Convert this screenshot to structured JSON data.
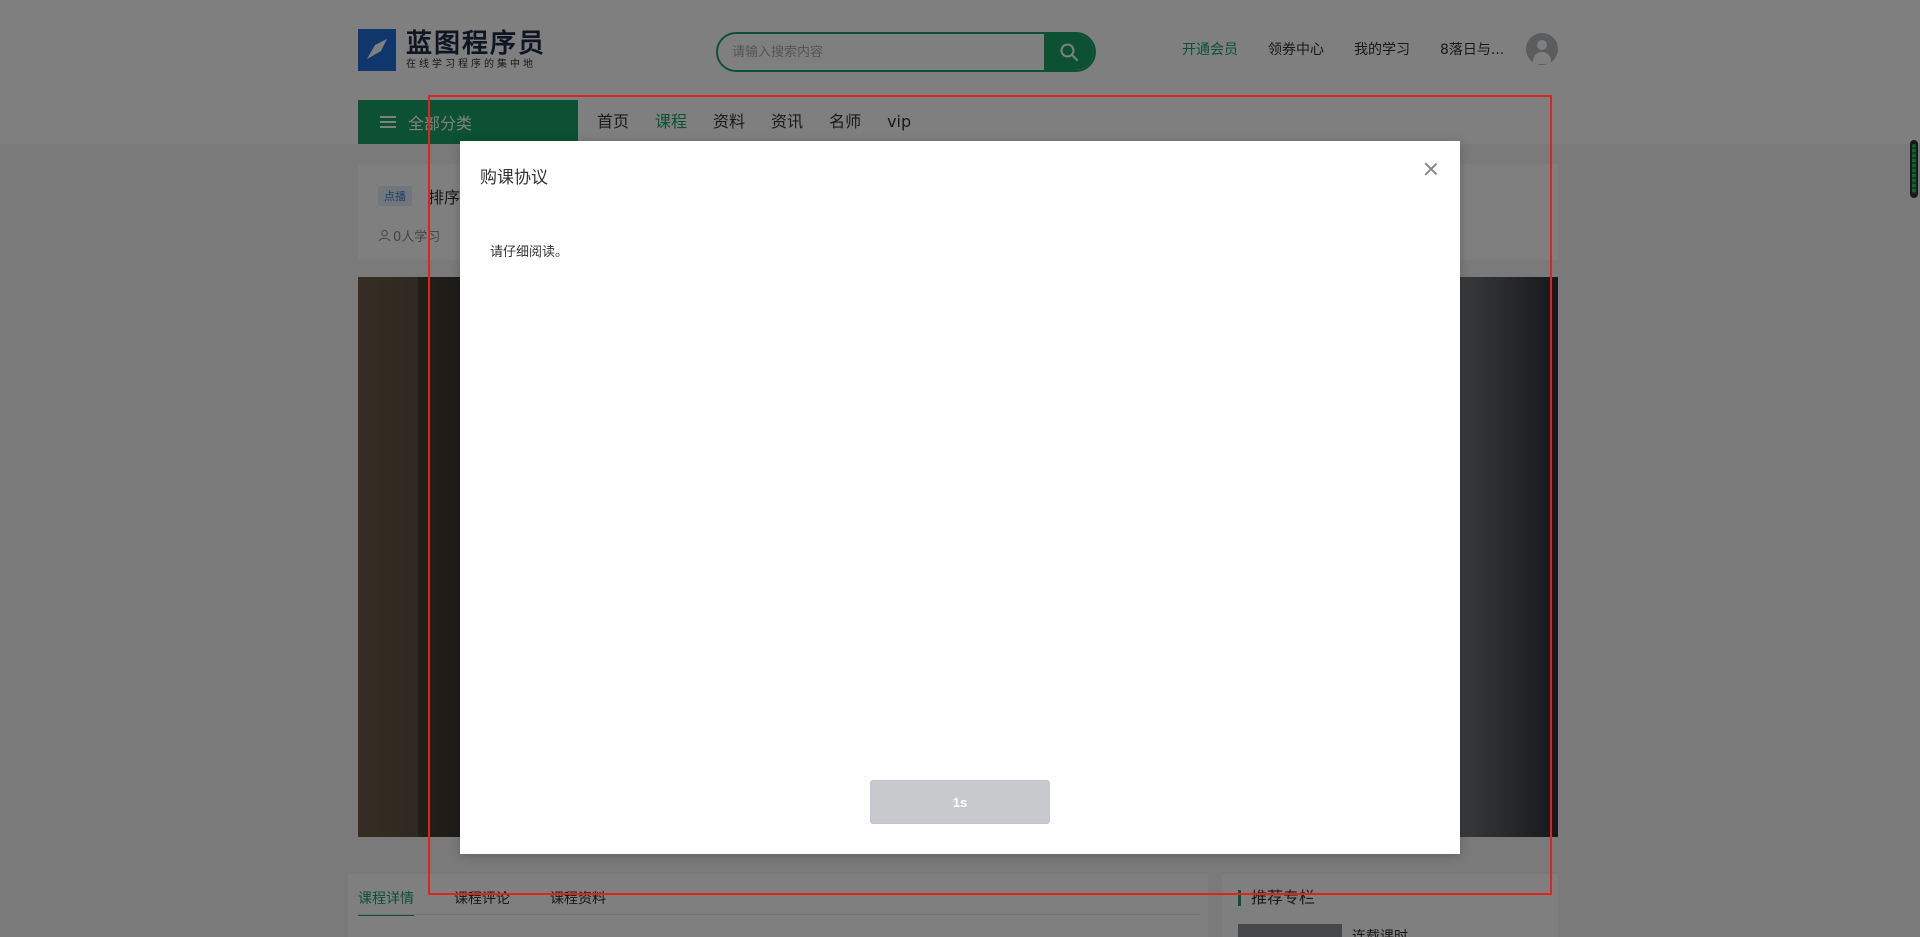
{
  "header": {
    "logo_title": "蓝图程序员",
    "logo_subtitle": "在线学习程序的集中地",
    "search_placeholder": "请输入搜索内容",
    "links": [
      "开通会员",
      "领券中心",
      "我的学习",
      "8落日与..."
    ],
    "all_categories": "全部分类",
    "nav": [
      "首页",
      "课程",
      "资料",
      "资讯",
      "名师",
      "vip"
    ],
    "nav_active": "课程"
  },
  "course": {
    "tag": "点播",
    "title": "排序",
    "learners": "0人学习"
  },
  "tabs": [
    "课程详情",
    "课程评论",
    "课程资料"
  ],
  "sidebar": {
    "title": "推荐专栏",
    "item": "连载课时"
  },
  "modal": {
    "title": "购课协议",
    "body": "请仔细阅读。",
    "button": "1s"
  },
  "colors": {
    "brand_green": "#1aa36b",
    "highlight_red": "#e0241b",
    "button_disabled": "#c8c9cc"
  }
}
